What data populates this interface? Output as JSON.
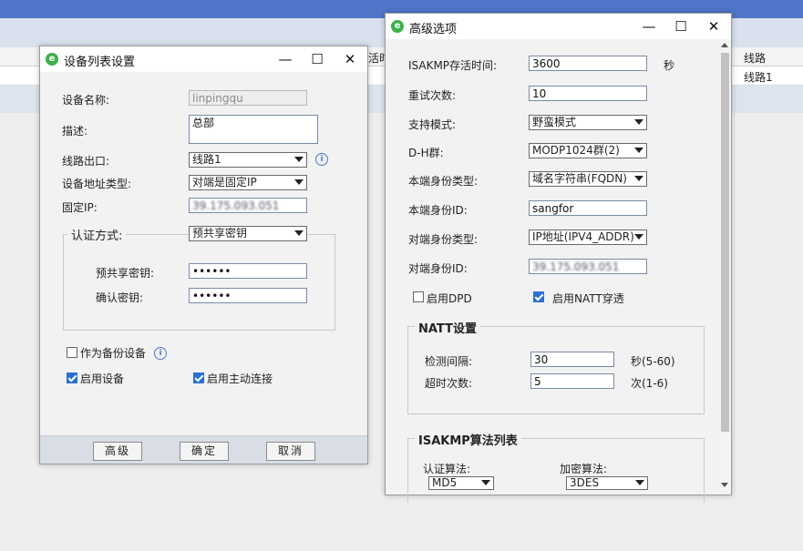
{
  "background": {
    "header_partial": "活时",
    "line_header": "线路",
    "line_value": "线路1"
  },
  "device_dialog": {
    "title": "设备列表设置",
    "labels": {
      "device_name": "设备名称:",
      "description": "描述:",
      "line_exit": "线路出口:",
      "address_type": "设备地址类型:",
      "fixed_ip": "固定IP:",
      "auth_method": "认证方式:",
      "preshared_key": "预共享密钥:",
      "confirm_key": "确认密钥:"
    },
    "values": {
      "device_name": "linpingqu",
      "description": "总部",
      "line_exit": "线路1",
      "address_type": "对端是固定IP",
      "fixed_ip": "39.175.093.051",
      "auth_method": "预共享密钥",
      "preshared_key": "••••••",
      "confirm_key": "••••••"
    },
    "checkboxes": {
      "backup_device": {
        "label": "作为备份设备",
        "checked": false
      },
      "enable_device": {
        "label": "启用设备",
        "checked": true
      },
      "active_connect": {
        "label": "启用主动连接",
        "checked": true
      }
    },
    "buttons": {
      "advanced": "高级",
      "ok": "确定",
      "cancel": "取消"
    }
  },
  "advanced_dialog": {
    "title": "高级选项",
    "labels": {
      "isakmp_lifetime": "ISAKMP存活时间:",
      "retry_count": "重试次数:",
      "support_mode": "支持模式:",
      "dh_group": "D-H群:",
      "local_id_type": "本端身份类型:",
      "local_id": "本端身份ID:",
      "peer_id_type": "对端身份类型:",
      "peer_id": "对端身份ID:"
    },
    "values": {
      "isakmp_lifetime": "3600",
      "isakmp_unit": "秒",
      "retry_count": "10",
      "support_mode": "野蛮模式",
      "dh_group": "MODP1024群(2)",
      "local_id_type": "域名字符串(FQDN)",
      "local_id": "sangfor",
      "peer_id_type": "IP地址(IPV4_ADDR)",
      "peer_id": "39.175.093.051"
    },
    "checkboxes": {
      "dpd": {
        "label": "启用DPD",
        "checked": false
      },
      "natt": {
        "label": "启用NATT穿透",
        "checked": true
      }
    },
    "natt_group": {
      "title": "NATT设置",
      "detect_label": "检测间隔:",
      "detect_value": "30",
      "detect_unit": "秒(5-60)",
      "timeout_label": "超时次数:",
      "timeout_value": "5",
      "timeout_unit": "次(1-6)"
    },
    "isakmp_group": {
      "title": "ISAKMP算法列表",
      "auth_label": "认证算法:",
      "auth_value": "MD5",
      "enc_label": "加密算法:",
      "enc_value": "3DES"
    }
  }
}
